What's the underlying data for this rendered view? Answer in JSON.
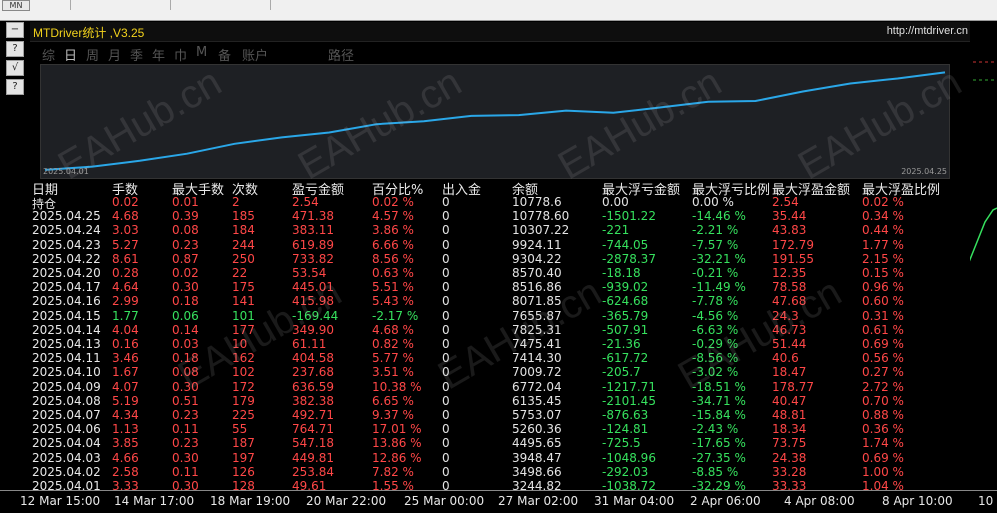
{
  "toolbar": {
    "timeframe": "MN"
  },
  "side_buttons": [
    "−",
    "?",
    "√",
    "?"
  ],
  "panel": {
    "title": "MTDriver统计 ,V3.25",
    "url": "http://mtdriver.cn"
  },
  "tabs": [
    "综",
    "日",
    "周",
    "月",
    "季",
    "年",
    "巾",
    "M",
    "备",
    "账户",
    "路径"
  ],
  "chart": {
    "date_start": "2025.04.01",
    "date_end": "2025.04.25",
    "line_color": "#2aa7e8"
  },
  "headers": [
    "日期",
    "手数",
    "最大手数",
    "次数",
    "盈亏金额",
    "百分比%",
    "出入金",
    "余额",
    "最大浮亏金额",
    "最大浮亏比例",
    "最大浮盈金额",
    "最大浮盈比例"
  ],
  "holdings": {
    "label": "持仓",
    "lots": "0.02",
    "max_lots": "0.01",
    "count": "2",
    "pl": "2.54",
    "pct": "0.02 %",
    "deposit": "0",
    "balance": "10778.6",
    "max_float_loss": "0.00",
    "max_float_loss_pct": "0.00 %",
    "max_float_profit": "2.54",
    "max_float_profit_pct": "0.02 %"
  },
  "rows": [
    {
      "date": "2025.04.25",
      "lots": "4.68",
      "max_lots": "0.39",
      "count": "185",
      "pl": "471.38",
      "pct": "4.57 %",
      "dep": "0",
      "bal": "10778.60",
      "mfl": "-1501.22",
      "mflp": "-14.46 %",
      "mfp": "35.44",
      "mfpp": "0.34 %",
      "dir": "up"
    },
    {
      "date": "2025.04.24",
      "lots": "3.03",
      "max_lots": "0.08",
      "count": "184",
      "pl": "383.11",
      "pct": "3.86 %",
      "dep": "0",
      "bal": "10307.22",
      "mfl": "-221",
      "mflp": "-2.21 %",
      "mfp": "43.83",
      "mfpp": "0.44 %",
      "dir": "up"
    },
    {
      "date": "2025.04.23",
      "lots": "5.27",
      "max_lots": "0.23",
      "count": "244",
      "pl": "619.89",
      "pct": "6.66 %",
      "dep": "0",
      "bal": "9924.11",
      "mfl": "-744.05",
      "mflp": "-7.57 %",
      "mfp": "172.79",
      "mfpp": "1.77 %",
      "dir": "up"
    },
    {
      "date": "2025.04.22",
      "lots": "8.61",
      "max_lots": "0.87",
      "count": "250",
      "pl": "733.82",
      "pct": "8.56 %",
      "dep": "0",
      "bal": "9304.22",
      "mfl": "-2878.37",
      "mflp": "-32.21 %",
      "mfp": "191.55",
      "mfpp": "2.15 %",
      "dir": "up"
    },
    {
      "date": "2025.04.20",
      "lots": "0.28",
      "max_lots": "0.02",
      "count": "22",
      "pl": "53.54",
      "pct": "0.63 %",
      "dep": "0",
      "bal": "8570.40",
      "mfl": "-18.18",
      "mflp": "-0.21 %",
      "mfp": "12.35",
      "mfpp": "0.15 %",
      "dir": "up"
    },
    {
      "date": "2025.04.17",
      "lots": "4.64",
      "max_lots": "0.30",
      "count": "175",
      "pl": "445.01",
      "pct": "5.51 %",
      "dep": "0",
      "bal": "8516.86",
      "mfl": "-939.02",
      "mflp": "-11.49 %",
      "mfp": "78.58",
      "mfpp": "0.96 %",
      "dir": "up"
    },
    {
      "date": "2025.04.16",
      "lots": "2.99",
      "max_lots": "0.18",
      "count": "141",
      "pl": "415.98",
      "pct": "5.43 %",
      "dep": "0",
      "bal": "8071.85",
      "mfl": "-624.68",
      "mflp": "-7.78 %",
      "mfp": "47.68",
      "mfpp": "0.60 %",
      "dir": "up"
    },
    {
      "date": "2025.04.15",
      "lots": "1.77",
      "max_lots": "0.06",
      "count": "101",
      "pl": "-169.44",
      "pct": "-2.17 %",
      "dep": "0",
      "bal": "7655.87",
      "mfl": "-365.79",
      "mflp": "-4.56 %",
      "mfp": "24.3",
      "mfpp": "0.31 %",
      "dir": "down"
    },
    {
      "date": "2025.04.14",
      "lots": "4.04",
      "max_lots": "0.14",
      "count": "177",
      "pl": "349.90",
      "pct": "4.68 %",
      "dep": "0",
      "bal": "7825.31",
      "mfl": "-507.91",
      "mflp": "-6.63 %",
      "mfp": "46.73",
      "mfpp": "0.61 %",
      "dir": "up"
    },
    {
      "date": "2025.04.13",
      "lots": "0.16",
      "max_lots": "0.03",
      "count": "10",
      "pl": "61.11",
      "pct": "0.82 %",
      "dep": "0",
      "bal": "7475.41",
      "mfl": "-21.36",
      "mflp": "-0.29 %",
      "mfp": "51.44",
      "mfpp": "0.69 %",
      "dir": "up"
    },
    {
      "date": "2025.04.11",
      "lots": "3.46",
      "max_lots": "0.18",
      "count": "162",
      "pl": "404.58",
      "pct": "5.77 %",
      "dep": "0",
      "bal": "7414.30",
      "mfl": "-617.72",
      "mflp": "-8.56 %",
      "mfp": "40.6",
      "mfpp": "0.56 %",
      "dir": "up"
    },
    {
      "date": "2025.04.10",
      "lots": "1.67",
      "max_lots": "0.08",
      "count": "102",
      "pl": "237.68",
      "pct": "3.51 %",
      "dep": "0",
      "bal": "7009.72",
      "mfl": "-205.7",
      "mflp": "-3.02 %",
      "mfp": "18.47",
      "mfpp": "0.27 %",
      "dir": "up"
    },
    {
      "date": "2025.04.09",
      "lots": "4.07",
      "max_lots": "0.30",
      "count": "172",
      "pl": "636.59",
      "pct": "10.38 %",
      "dep": "0",
      "bal": "6772.04",
      "mfl": "-1217.71",
      "mflp": "-18.51 %",
      "mfp": "178.77",
      "mfpp": "2.72 %",
      "dir": "up"
    },
    {
      "date": "2025.04.08",
      "lots": "5.19",
      "max_lots": "0.51",
      "count": "179",
      "pl": "382.38",
      "pct": "6.65 %",
      "dep": "0",
      "bal": "6135.45",
      "mfl": "-2101.45",
      "mflp": "-34.71 %",
      "mfp": "40.47",
      "mfpp": "0.70 %",
      "dir": "up"
    },
    {
      "date": "2025.04.07",
      "lots": "4.34",
      "max_lots": "0.23",
      "count": "225",
      "pl": "492.71",
      "pct": "9.37 %",
      "dep": "0",
      "bal": "5753.07",
      "mfl": "-876.63",
      "mflp": "-15.84 %",
      "mfp": "48.81",
      "mfpp": "0.88 %",
      "dir": "up"
    },
    {
      "date": "2025.04.06",
      "lots": "1.13",
      "max_lots": "0.11",
      "count": "55",
      "pl": "764.71",
      "pct": "17.01 %",
      "dep": "0",
      "bal": "5260.36",
      "mfl": "-124.81",
      "mflp": "-2.43 %",
      "mfp": "18.34",
      "mfpp": "0.36 %",
      "dir": "up"
    },
    {
      "date": "2025.04.04",
      "lots": "3.85",
      "max_lots": "0.23",
      "count": "187",
      "pl": "547.18",
      "pct": "13.86 %",
      "dep": "0",
      "bal": "4495.65",
      "mfl": "-725.5",
      "mflp": "-17.65 %",
      "mfp": "73.75",
      "mfpp": "1.74 %",
      "dir": "up"
    },
    {
      "date": "2025.04.03",
      "lots": "4.66",
      "max_lots": "0.30",
      "count": "197",
      "pl": "449.81",
      "pct": "12.86 %",
      "dep": "0",
      "bal": "3948.47",
      "mfl": "-1048.96",
      "mflp": "-27.35 %",
      "mfp": "24.38",
      "mfpp": "0.69 %",
      "dir": "up"
    },
    {
      "date": "2025.04.02",
      "lots": "2.58",
      "max_lots": "0.11",
      "count": "126",
      "pl": "253.84",
      "pct": "7.82 %",
      "dep": "0",
      "bal": "3498.66",
      "mfl": "-292.03",
      "mflp": "-8.85 %",
      "mfp": "33.28",
      "mfpp": "1.00 %",
      "dir": "up"
    },
    {
      "date": "2025.04.01",
      "lots": "3.33",
      "max_lots": "0.30",
      "count": "128",
      "pl": "49.61",
      "pct": "1.55 %",
      "dep": "0",
      "bal": "3244.82",
      "mfl": "-1038.72",
      "mflp": "-32.29 %",
      "mfp": "33.33",
      "mfpp": "1.04 %",
      "dir": "up"
    }
  ],
  "xaxis": [
    "12 Mar 15:00",
    "14 Mar 17:00",
    "18 Mar 19:00",
    "20 Mar 22:00",
    "25 Mar 00:00",
    "27 Mar 02:00",
    "31 Mar 04:00",
    "2 Apr 06:00",
    "4 Apr 08:00",
    "8 Apr 10:00",
    "10"
  ],
  "watermark": "EAHub.cn"
}
